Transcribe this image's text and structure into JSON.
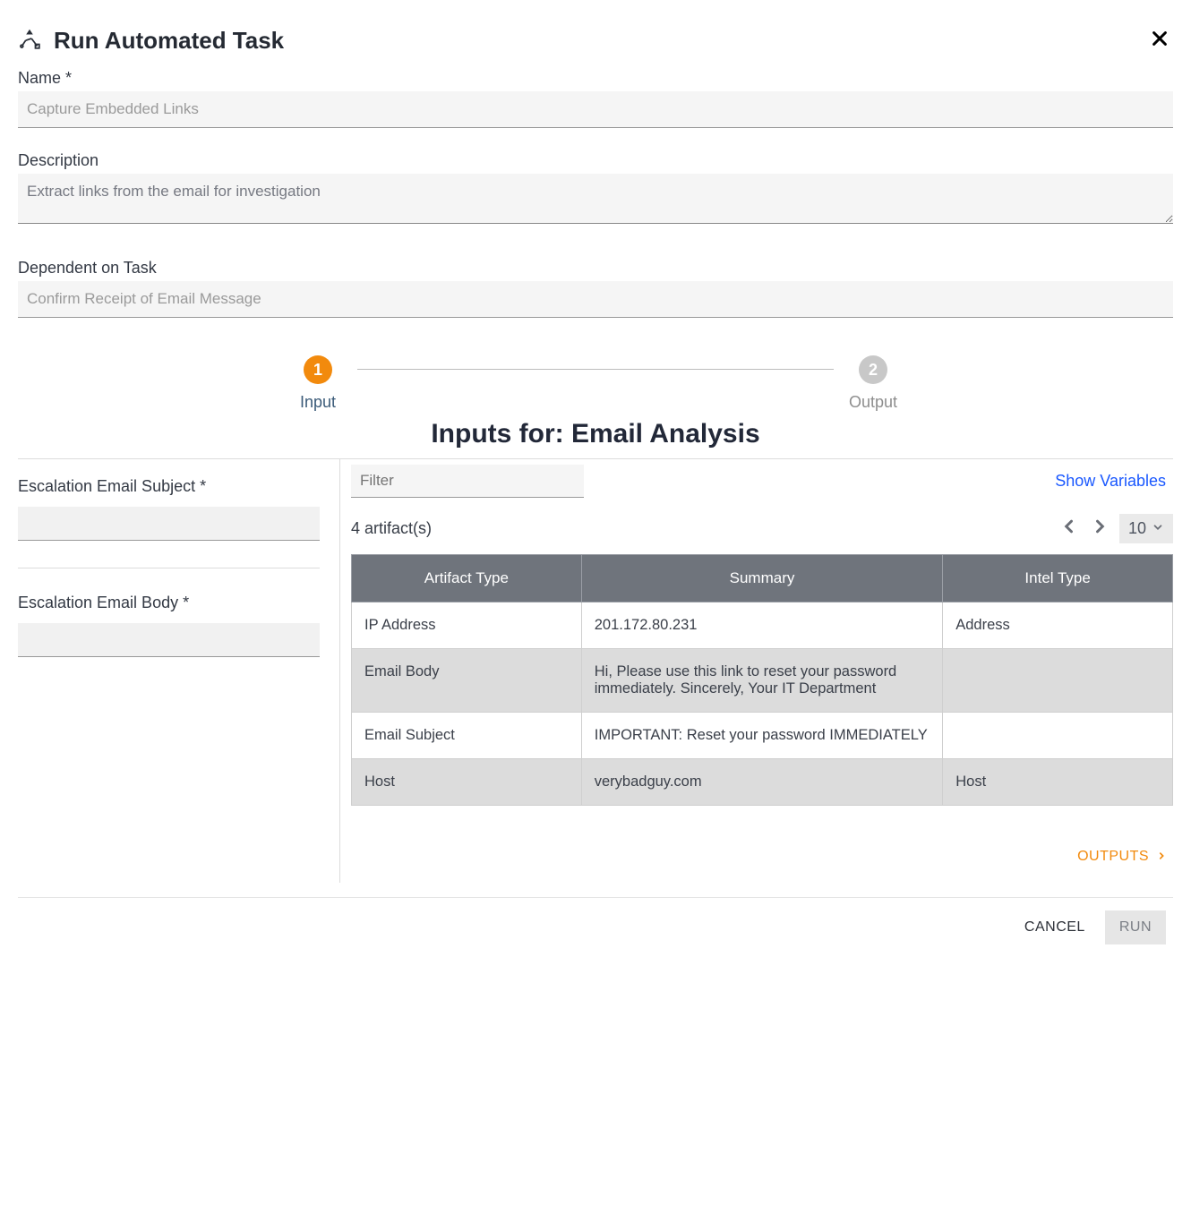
{
  "header": {
    "title": "Run Automated Task"
  },
  "fields": {
    "name_label": "Name *",
    "name_value": "Capture Embedded Links",
    "description_label": "Description",
    "description_value": "Extract links from the email for investigation",
    "dependent_label": "Dependent on Task",
    "dependent_value": "Confirm Receipt of Email Message"
  },
  "stepper": {
    "step1_num": "1",
    "step1_label": "Input",
    "step2_num": "2",
    "step2_label": "Output"
  },
  "inputs_section": {
    "title": "Inputs for: Email Analysis",
    "esc_subject_label": "Escalation Email Subject *",
    "esc_body_label": "Escalation Email Body *",
    "filter_placeholder": "Filter",
    "show_variables": "Show Variables",
    "count_label": "4 artifact(s)",
    "page_size": "10",
    "columns": [
      "Artifact Type",
      "Summary",
      "Intel Type"
    ],
    "rows": [
      {
        "artifact_type": "IP Address",
        "summary": "201.172.80.231",
        "intel_type": "Address"
      },
      {
        "artifact_type": "Email Body",
        "summary": "Hi, Please use this link to reset your password immediately. Sincerely, Your IT Department",
        "intel_type": ""
      },
      {
        "artifact_type": "Email Subject",
        "summary": "IMPORTANT: Reset your password IMMEDIATELY",
        "intel_type": ""
      },
      {
        "artifact_type": "Host",
        "summary": "verybadguy.com",
        "intel_type": "Host"
      }
    ]
  },
  "outputs_link": "OUTPUTS",
  "footer": {
    "cancel": "CANCEL",
    "run": "RUN"
  }
}
